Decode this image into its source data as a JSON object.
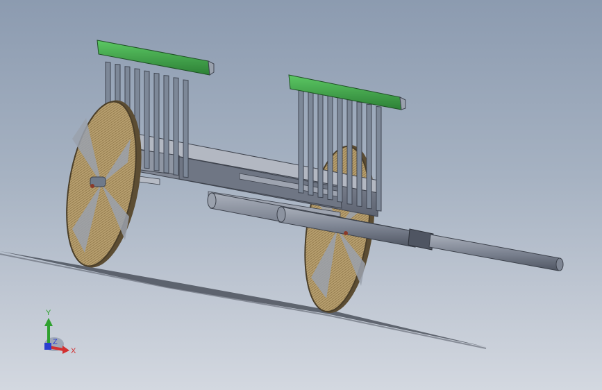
{
  "view": {
    "background_top": "#8c9bb0",
    "background_bottom": "#d3d8e0"
  },
  "model": {
    "name": "cart-with-bench-seats",
    "colors": {
      "seat_top": "#3fa046",
      "frame": "#7a8190",
      "wheel": "#b59b6a",
      "shaft": "#7f8694",
      "spindle": "#6f7a8a"
    }
  },
  "triad": {
    "x_label": "X",
    "y_label": "Y",
    "z_label": "Z",
    "x_color": "#d23030",
    "y_color": "#2fa12f",
    "z_color": "#2b3fcf"
  }
}
